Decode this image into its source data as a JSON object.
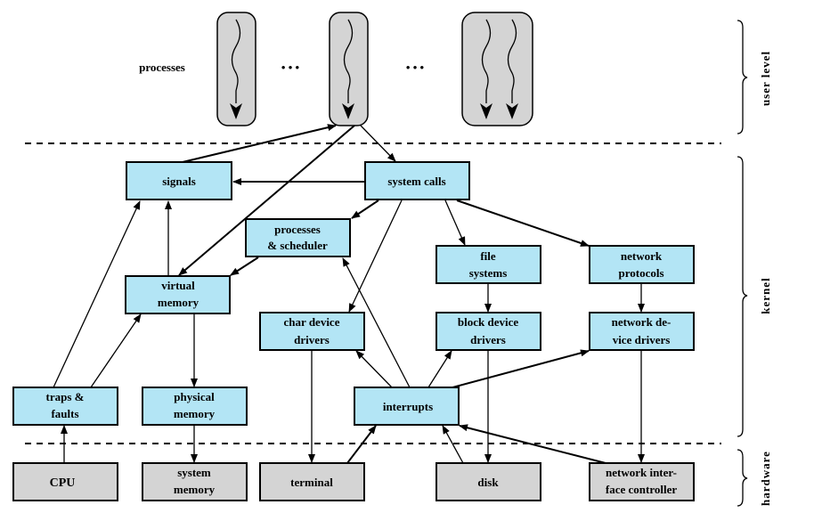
{
  "processes_label": "processes",
  "ellipsis": [
    "• • •",
    "• • •"
  ],
  "levels": {
    "user": "user level",
    "kernel": "kernel",
    "hardware": "hardware"
  },
  "kernel_boxes": {
    "signals": [
      "signals"
    ],
    "system_calls": [
      "system calls"
    ],
    "scheduler": [
      "processes",
      "& scheduler"
    ],
    "file_systems": [
      "file",
      "systems"
    ],
    "network_protocols": [
      "network",
      "protocols"
    ],
    "virtual_memory": [
      "virtual",
      "memory"
    ],
    "char_drivers": [
      "char device",
      "drivers"
    ],
    "block_drivers": [
      "block device",
      "drivers"
    ],
    "net_drivers": [
      "network de-",
      "vice drivers"
    ],
    "traps": [
      "traps &",
      "faults"
    ],
    "physical_memory": [
      "physical",
      "memory"
    ],
    "interrupts": [
      "interrupts"
    ]
  },
  "hardware_boxes": {
    "cpu": [
      "CPU"
    ],
    "system_memory": [
      "system",
      "memory"
    ],
    "terminal": [
      "terminal"
    ],
    "disk": [
      "disk"
    ],
    "nic": [
      "network inter-",
      "face controller"
    ]
  },
  "colors": {
    "kernel": "#b3e5f5",
    "hardware": "#d4d4d4"
  }
}
